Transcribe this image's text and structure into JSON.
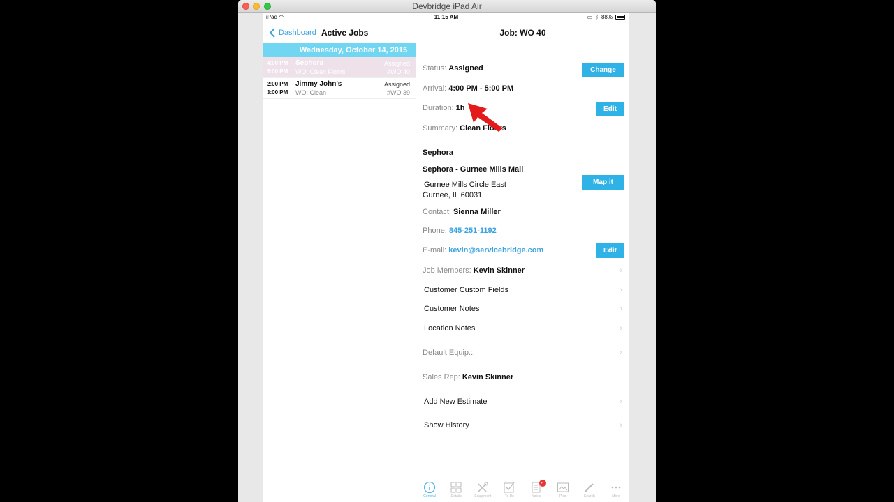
{
  "window": {
    "title": "Devbridge iPad Air"
  },
  "statusbar": {
    "device": "iPad",
    "time": "11:15 AM",
    "battery": "88%"
  },
  "master": {
    "back_label": "Dashboard",
    "title": "Active Jobs",
    "date_header": "Wednesday, October 14, 2015",
    "jobs": [
      {
        "start": "4:00 PM",
        "end": "5:00 PM",
        "name": "Sephora",
        "wo": "WO: Clean Floors",
        "status": "Assigned",
        "number": "#WO 40"
      },
      {
        "start": "2:00 PM",
        "end": "3:00 PM",
        "name": "Jimmy John's",
        "wo": "WO: Clean",
        "status": "Assigned",
        "number": "#WO 39"
      }
    ]
  },
  "detail": {
    "title": "Job: WO 40",
    "status_label": "Status:",
    "status_value": "Assigned",
    "change_button": "Change",
    "arrival_label": "Arrival:",
    "arrival_value": "4:00 PM - 5:00 PM",
    "duration_label": "Duration:",
    "duration_value": "1h",
    "duration_edit": "Edit",
    "summary_label": "Summary:",
    "summary_value": "Clean Floors",
    "customer": "Sephora",
    "location_name": "Sephora - Gurnee Mills Mall",
    "address1": "Gurnee Mills Circle East",
    "address2": "Gurnee, IL 60031",
    "map_button": "Map it",
    "contact_label": "Contact:",
    "contact_value": "Sienna Miller",
    "phone_label": "Phone:",
    "phone_value": "845-251-1192",
    "email_label": "E-mail:",
    "email_value": "kevin@servicebridge.com",
    "email_edit": "Edit",
    "members_label": "Job Members:",
    "members_value": "Kevin Skinner",
    "custom_fields": "Customer Custom Fields",
    "customer_notes": "Customer Notes",
    "location_notes": "Location Notes",
    "default_equip": "Default Equip.:",
    "sales_rep_label": "Sales Rep:",
    "sales_rep_value": "Kevin Skinner",
    "add_estimate": "Add New Estimate",
    "show_history": "Show History"
  },
  "tabs": [
    {
      "label": "General",
      "icon": "info-icon"
    },
    {
      "label": "Details",
      "icon": "grid-icon"
    },
    {
      "label": "Equipment",
      "icon": "tools-icon"
    },
    {
      "label": "To Do",
      "icon": "checkbox-icon"
    },
    {
      "label": "Notes",
      "icon": "notes-icon"
    },
    {
      "label": "Pics",
      "icon": "image-icon"
    },
    {
      "label": "Search",
      "icon": "pencil-icon"
    },
    {
      "label": "More",
      "icon": "ellipsis-icon"
    }
  ],
  "colors": {
    "accent": "#2fb2e6",
    "link": "#3aa2e0",
    "date_header": "#71d6f2",
    "selected_row": "#eee1ea",
    "cursor": "#e31b1b"
  }
}
